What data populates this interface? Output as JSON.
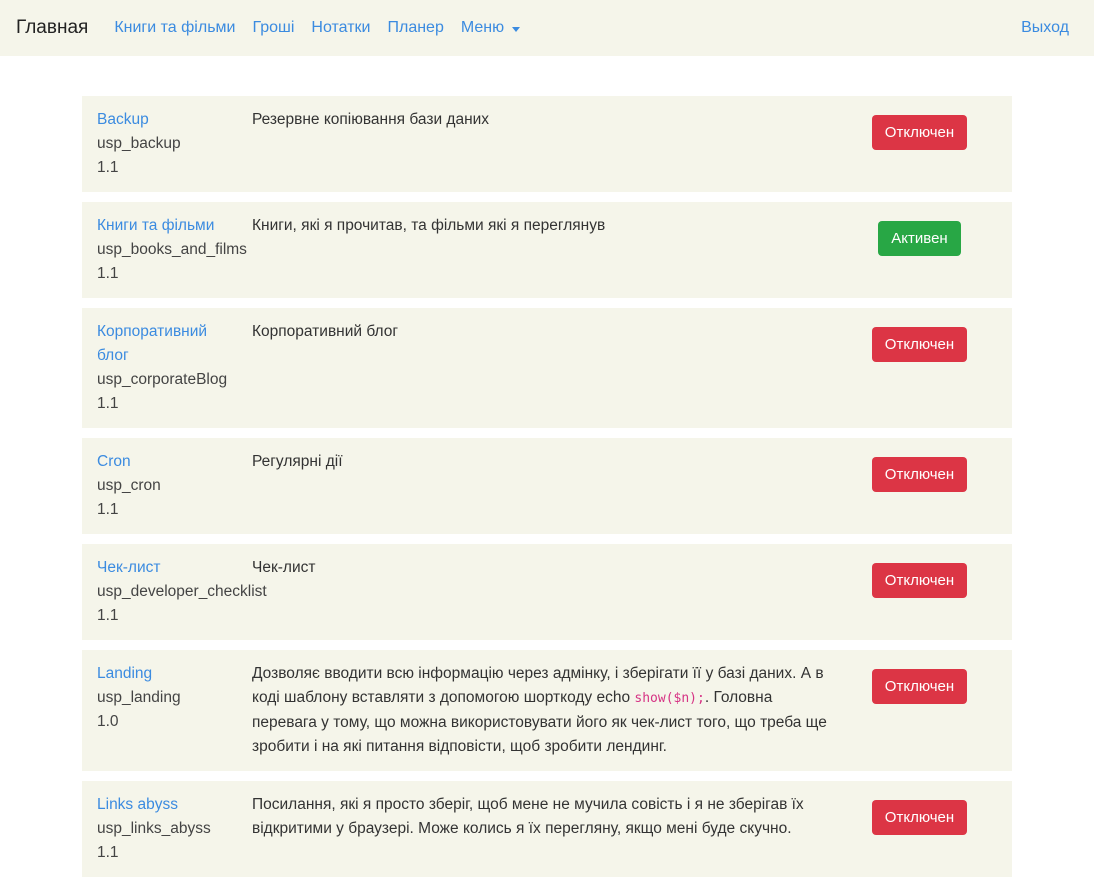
{
  "navbar": {
    "brand": "Главная",
    "items": [
      {
        "label": "Книги та фільми"
      },
      {
        "label": "Гроші"
      },
      {
        "label": "Нотатки"
      },
      {
        "label": "Планер"
      }
    ],
    "menu_label": "Меню",
    "logout_label": "Выход"
  },
  "modules": [
    {
      "title": "Backup",
      "slug": "usp_backup",
      "version": "1.1",
      "description": "Резервне копіювання бази даних",
      "status": "Отключен"
    },
    {
      "title": "Книги та фільми",
      "slug": "usp_books_and_films",
      "version": "1.1",
      "description": "Книги, які я прочитав, та фільми які я переглянув",
      "status": "Активен"
    },
    {
      "title": "Корпоративний блог",
      "slug": "usp_corporateBlog",
      "version": "1.1",
      "description": "Корпоративний блог",
      "status": "Отключен"
    },
    {
      "title": "Cron",
      "slug": "usp_cron",
      "version": "1.1",
      "description": "Регулярні дії",
      "status": "Отключен"
    },
    {
      "title": "Чек-лист",
      "slug": "usp_developer_checklist",
      "version": "1.1",
      "description": "Чек-лист",
      "status": "Отключен"
    },
    {
      "title": "Landing",
      "slug": "usp_landing",
      "version": "1.0",
      "description_before": "Дозволяє вводити всю інформацію через адмінку, і зберігати її у базі даних. А в коді шаблону вставляти з допомогою шорткоду echo ",
      "description_code": "show($n);",
      "description_after": ". Головна перевага у тому, що можна використовувати його як чек-лист того, що треба ще зробити і на які питання відповісти, щоб зробити лендинг.",
      "status": "Отключен"
    },
    {
      "title": "Links abyss",
      "slug": "usp_links_abyss",
      "version": "1.1",
      "description": "Посилання, які я просто зберіг, щоб мене не мучила совість і я не зберігав їх відкритими у браузері. Може колись я їх перегляну, якщо мені буде скучно.",
      "status": "Отключен"
    }
  ],
  "colors": {
    "accent": "#3b8be0",
    "disabled": "#dc3545",
    "active": "#28a745",
    "panel": "#f5f5ea"
  }
}
